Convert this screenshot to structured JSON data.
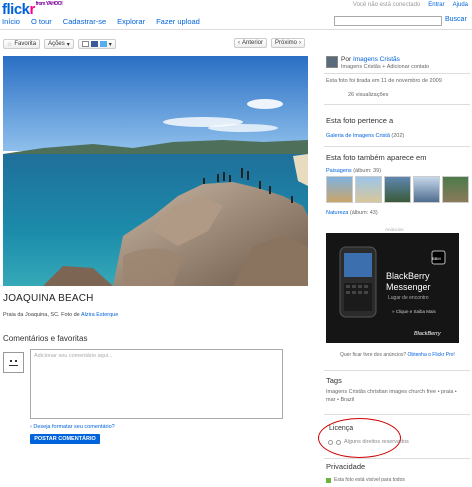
{
  "header": {
    "logo_text": "flickr",
    "logo_sub": "from YAHOO!",
    "nav": [
      "Início",
      "O tour",
      "Cadastrar-se",
      "Explorar",
      "Fazer upload"
    ],
    "status": "Você não está conectado",
    "login": "Entrar",
    "help": "Ajuda",
    "search_button": "Buscar"
  },
  "toolbar": {
    "favorite": "Favorita",
    "actions": "Ações",
    "prev": "Anterior",
    "next": "Próximo"
  },
  "photo": {
    "title": "JOAQUINA BEACH",
    "caption_prefix": "Praia da Joaquina, SC. Foto de",
    "caption_author": "Alzira Esterque"
  },
  "comments": {
    "heading": "Comentários e favoritas",
    "placeholder": "Adicionar seu comentário aqui...",
    "format_link": "Deseja formatar seu comentário?",
    "post_button": "POSTAR COMENTÁRIO"
  },
  "sidebar": {
    "by": "Por",
    "owner": "Imagens Cristãs",
    "owner_line": "Imagens Cristãs   + Adicionar contato",
    "taken": "Esta foto foi tirada em 11 de novembro de 2009",
    "views": "26 visualizações",
    "belongs_heading": "Esta foto pertence a",
    "gallery": "Galeria de Imagens Cristã",
    "gallery_count": "(202)",
    "also_heading": "Esta foto também aparece em",
    "album1": "Paisagens",
    "album1_count": "(álbum: 39)",
    "album2": "Natureza",
    "album2_count": "(álbum: 43)",
    "ad_label": "Anúncios",
    "ad_title1": "BlackBerry",
    "ad_title2": "Messenger",
    "ad_tagline": "Lugar de encontro",
    "ad_cta": "» Clique e Saiba Mais",
    "ad_brand": "BlackBerry",
    "ad_question": "Quer ficar livre dos anúncios?",
    "ad_pro": "Obtenha o Flickr Pro!",
    "tags_heading": "Tags",
    "tags": "Imagens Cristãs   christian images   church free   •   praia   •   mar   •   Brazil",
    "license_heading": "Licença",
    "license_text": "Alguns direitos reservados",
    "privacy_heading": "Privacidade",
    "privacy_text": "Esta foto está visível para todos"
  },
  "colors": {
    "link": "#0063dc",
    "pink": "#ff0084",
    "annotation": "#d10000"
  }
}
